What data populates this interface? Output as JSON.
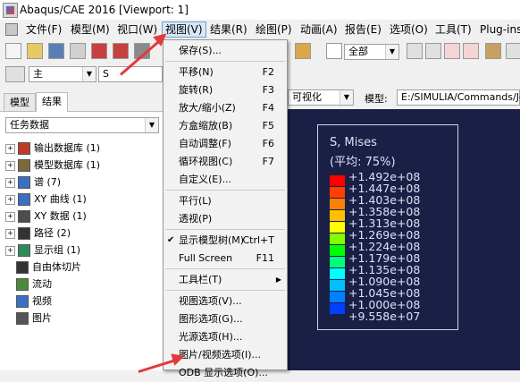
{
  "window": {
    "title": "Abaqus/CAE 2016 [Viewport: 1]"
  },
  "menubar": {
    "items": [
      "文件(F)",
      "模型(M)",
      "视口(W)",
      "视图(V)",
      "结果(R)",
      "绘图(P)",
      "动画(A)",
      "报告(E)",
      "选项(O)",
      "工具(T)",
      "Plug-ins"
    ]
  },
  "toolbar": {
    "selection_combo": "全部",
    "module_combo": "主",
    "s_field": "S",
    "visualization_combo": "可视化",
    "model_label": "模型:",
    "model_path": "E:/SIMULIA/Commands/Jo"
  },
  "tree": {
    "tabs": [
      "模型",
      "结果"
    ],
    "selected_tab": "结果",
    "filter_combo": "任务数据",
    "items": [
      {
        "label": "输出数据库 (1)",
        "expand": "+",
        "icon": "database-icon",
        "color": "#c0392b"
      },
      {
        "label": "模型数据库 (1)",
        "expand": "+",
        "icon": "model-db-icon",
        "color": "#7a6a3a"
      },
      {
        "label": "谱 (7)",
        "expand": "+",
        "icon": "spectrum-icon",
        "color": "#3a6fc4"
      },
      {
        "label": "XY 曲线 (1)",
        "expand": "+",
        "icon": "xy-curve-icon",
        "color": "#3a6fc4"
      },
      {
        "label": "XY 数据 (1)",
        "expand": "+",
        "icon": "xy-data-icon",
        "color": "#4d4d4d"
      },
      {
        "label": "路径 (2)",
        "expand": "+",
        "icon": "path-icon",
        "color": "#333333"
      },
      {
        "label": "显示组 (1)",
        "expand": "+",
        "icon": "display-group-icon",
        "color": "#2e8b57"
      },
      {
        "label": "自由体切片",
        "expand": "",
        "icon": "free-body-icon",
        "color": "#333333"
      },
      {
        "label": "流动",
        "expand": "",
        "icon": "flow-icon",
        "color": "#4a8a3a"
      },
      {
        "label": "视频",
        "expand": "",
        "icon": "video-icon",
        "color": "#3a6fc4"
      },
      {
        "label": "图片",
        "expand": "",
        "icon": "image-icon",
        "color": "#555555"
      }
    ]
  },
  "view_menu": {
    "items": [
      {
        "label": "保存(S)...",
        "shortcut": ""
      },
      {
        "label": "平移(N)",
        "shortcut": "F2"
      },
      {
        "label": "旋转(R)",
        "shortcut": "F3"
      },
      {
        "label": "放大/缩小(Z)",
        "shortcut": "F4"
      },
      {
        "label": "方盒缩放(B)",
        "shortcut": "F5"
      },
      {
        "label": "自动调整(F)",
        "shortcut": "F6"
      },
      {
        "label": "循环视图(C)",
        "shortcut": "F7"
      },
      {
        "label": "自定义(E)...",
        "shortcut": ""
      },
      {
        "label": "平行(L)",
        "shortcut": ""
      },
      {
        "label": "透视(P)",
        "shortcut": ""
      },
      {
        "label": "显示模型树(M)",
        "shortcut": "Ctrl+T",
        "checked": true
      },
      {
        "label": "Full Screen",
        "shortcut": "F11"
      },
      {
        "label": "工具栏(T)",
        "shortcut": "",
        "submenu": true
      },
      {
        "label": "视图选项(V)...",
        "shortcut": ""
      },
      {
        "label": "图形选项(G)...",
        "shortcut": ""
      },
      {
        "label": "光源选项(H)...",
        "shortcut": ""
      },
      {
        "label": "图片/视频选项(I)...",
        "shortcut": ""
      },
      {
        "label": "ODB 显示选项(O)...",
        "shortcut": ""
      }
    ],
    "check_mark": "✔",
    "submenu_arrow": "▶"
  },
  "legend": {
    "title": "S, Mises",
    "subtitle": "(平均: 75%)",
    "labels": [
      "+1.492e+08",
      "+1.447e+08",
      "+1.403e+08",
      "+1.358e+08",
      "+1.313e+08",
      "+1.269e+08",
      "+1.224e+08",
      "+1.179e+08",
      "+1.135e+08",
      "+1.090e+08",
      "+1.045e+08",
      "+1.000e+08",
      "+9.558e+07"
    ],
    "colors": [
      "#ff0000",
      "#ff4000",
      "#ff8000",
      "#ffbf00",
      "#ffff00",
      "#7fff00",
      "#00ff00",
      "#00ff7f",
      "#00ffff",
      "#00bfff",
      "#0080ff",
      "#0040ff",
      "#0000ff"
    ]
  },
  "colors": {
    "viewport_bg": "#1a1f46",
    "annotation_arrow": "#e23a3a",
    "menu_highlight": "#d8e6f7"
  }
}
